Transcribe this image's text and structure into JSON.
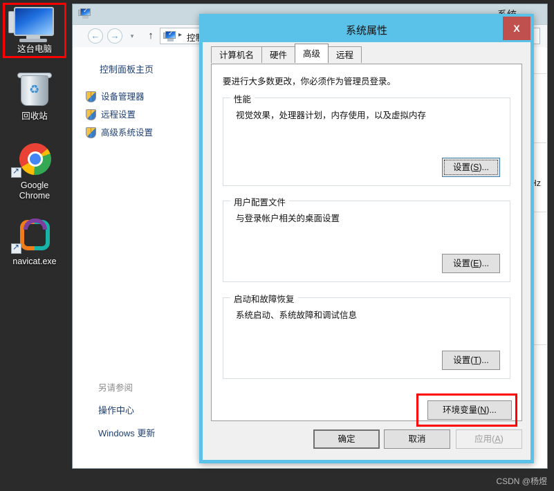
{
  "desktop": {
    "icons": [
      {
        "name": "this-pc",
        "label": "这台电脑",
        "glyph": "monitor-icon",
        "selected": true
      },
      {
        "name": "recycle-bin",
        "label": "回收站",
        "glyph": "recycle-bin-icon",
        "selected": false
      },
      {
        "name": "google-chrome",
        "label": "Google Chrome",
        "glyph": "chrome-icon",
        "selected": false
      },
      {
        "name": "navicat",
        "label": "navicat.exe",
        "glyph": "navicat-icon",
        "selected": false
      }
    ],
    "background_color": "#2b2b2b"
  },
  "explorer": {
    "title_icon": "computer-icon",
    "window_label": "系统",
    "nav": {
      "back": "←",
      "forward": "→",
      "recent_dropdown": "▾",
      "up": "↑"
    },
    "address": {
      "icon": "computer-icon",
      "separator": "▸",
      "crumb": "控制"
    },
    "sidebar": {
      "home": "控制面板主页",
      "items": [
        {
          "label": "设备管理器",
          "icon": "shield-icon",
          "highlighted": false
        },
        {
          "label": "远程设置",
          "icon": "shield-icon",
          "highlighted": false
        },
        {
          "label": "高级系统设置",
          "icon": "shield-icon",
          "highlighted": true
        }
      ],
      "see_also_header": "另请参阅",
      "see_also": [
        {
          "label": "操作中心"
        },
        {
          "label": "Windows 更新"
        }
      ]
    },
    "main": {
      "cpu_unit": "GHz"
    },
    "titlebar_color": "#c9d9df"
  },
  "dialog": {
    "title": "系统属性",
    "close_label": "X",
    "accent_color": "#5ac1e8",
    "close_color": "#c0504d",
    "tabs": [
      {
        "label": "计算机名",
        "active": false
      },
      {
        "label": "硬件",
        "active": false
      },
      {
        "label": "高级",
        "active": true
      },
      {
        "label": "远程",
        "active": false
      }
    ],
    "note": "要进行大多数更改，你必须作为管理员登录。",
    "groups": [
      {
        "name": "performance",
        "title": "性能",
        "description": "视觉效果，处理器计划，内存使用，以及虚拟内存",
        "button_label": "设置(S)...",
        "button_mnemonic": "S",
        "button_prefix": "设置(",
        "button_suffix": ")...",
        "focused": true
      },
      {
        "name": "user-profiles",
        "title": "用户配置文件",
        "description": "与登录帐户相关的桌面设置",
        "button_label": "设置(E)...",
        "button_mnemonic": "E",
        "button_prefix": "设置(",
        "button_suffix": ")...",
        "focused": false
      },
      {
        "name": "startup-recovery",
        "title": "启动和故障恢复",
        "description": "系统启动、系统故障和调试信息",
        "button_label": "设置(T)...",
        "button_mnemonic": "T",
        "button_prefix": "设置(",
        "button_suffix": ")...",
        "focused": false
      }
    ],
    "env_button": {
      "prefix": "环境变量(",
      "mnemonic": "N",
      "suffix": ")...",
      "highlighted": true,
      "highlight_color": "#ff0000"
    },
    "footer_buttons": [
      {
        "name": "ok",
        "label": "确定",
        "default": true,
        "disabled": false
      },
      {
        "name": "cancel",
        "label": "取消",
        "default": false,
        "disabled": false
      },
      {
        "name": "apply",
        "prefix": "应用(",
        "mnemonic": "A",
        "suffix": ")",
        "label": "应用(A)",
        "default": false,
        "disabled": true
      }
    ]
  },
  "watermark": "CSDN @杨煜"
}
